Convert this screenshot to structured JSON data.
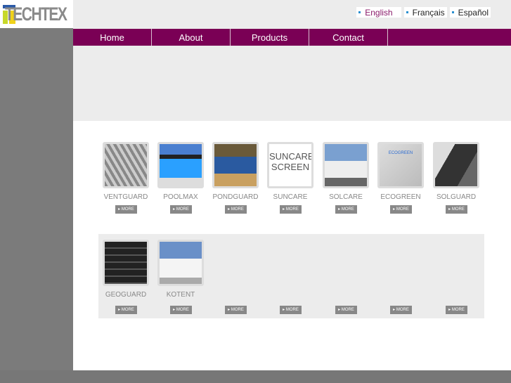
{
  "logo": {
    "text": "TECHTEX"
  },
  "languages": [
    {
      "label": "English",
      "active": true
    },
    {
      "label": "Français"
    },
    {
      "label": "Español"
    }
  ],
  "nav": [
    "Home",
    "About",
    "Products",
    "Contact",
    ""
  ],
  "products": [
    {
      "name": "VENTGUARD",
      "image": "grey-duct-hose"
    },
    {
      "name": "POOLMAX",
      "image": "swimming-pool"
    },
    {
      "name": "PONDGUARD",
      "image": "garden-pond"
    },
    {
      "name": "SUNCARE",
      "image": "suncare-screen-logo",
      "logo_text": [
        "SUNCARE",
        "SCREEN"
      ]
    },
    {
      "name": "SOLCARE",
      "image": "camper-van"
    },
    {
      "name": "ECOGREEN",
      "image": "ecogreen-fabric",
      "logo_text": [
        "ECOGREEN"
      ]
    },
    {
      "name": "SOLGUARD",
      "image": "black-fabric-roll"
    },
    {
      "name": "GEOGUARD",
      "image": "black-pipes"
    },
    {
      "name": "KOTENT",
      "image": "white-tent"
    }
  ],
  "more_label": "▸ MORE",
  "colors": {
    "nav": "#7a0055",
    "accent": "#8a1a6a"
  }
}
